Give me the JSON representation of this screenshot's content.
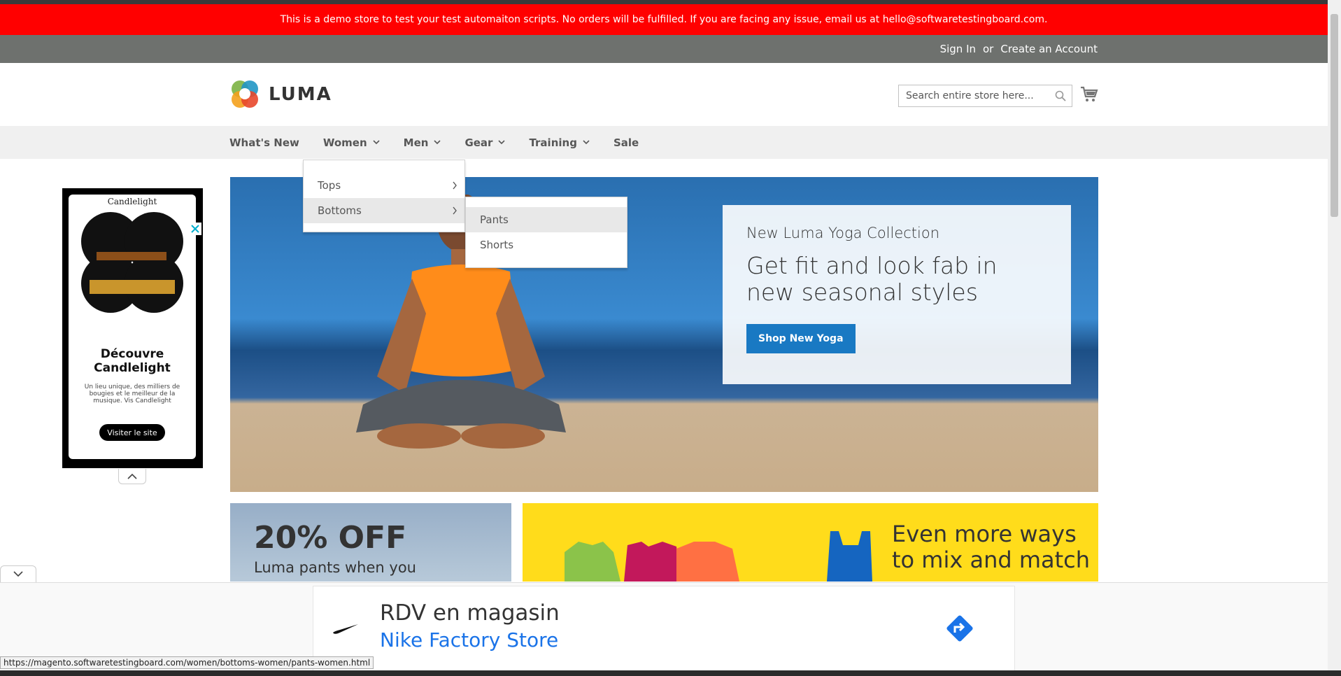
{
  "banner": {
    "text": "This is a demo store to test your test automaiton scripts. No orders will be fulfilled. If you are facing any issue, email us at hello@softwaretestingboard.com."
  },
  "panel": {
    "sign_in": "Sign In",
    "or": "or",
    "create_account": "Create an Account"
  },
  "logo": {
    "text": "LUMA"
  },
  "search": {
    "placeholder": "Search entire store here..."
  },
  "nav": {
    "items": [
      {
        "label": "What's New",
        "has_children": false
      },
      {
        "label": "Women",
        "has_children": true
      },
      {
        "label": "Men",
        "has_children": true
      },
      {
        "label": "Gear",
        "has_children": true
      },
      {
        "label": "Training",
        "has_children": true
      },
      {
        "label": "Sale",
        "has_children": false
      }
    ]
  },
  "dropdown": {
    "items": [
      "Tops",
      "Bottoms"
    ],
    "active": "Bottoms",
    "submenu": [
      "Pants",
      "Shorts"
    ],
    "submenu_active": "Pants"
  },
  "hero": {
    "kicker": "New Luma Yoga Collection",
    "title": "Get fit and look fab in new seasonal styles",
    "button": "Shop New Yoga"
  },
  "tiles": {
    "sale_big": "20% OFF",
    "sale_small": "Luma pants when you",
    "mix_text": "Even more ways to mix and match"
  },
  "side_ad": {
    "brand": "Candlelight",
    "title": "Découvre Candlelight",
    "body": "Un lieu unique, des milliers de bougies et le meilleur de la musique. Vis Candlelight",
    "button": "Visiter le site"
  },
  "bottom_ad": {
    "headline": "RDV en magasin",
    "sub": "Nike Factory Store"
  },
  "status_url": "https://magento.softwaretestingboard.com/women/bottoms-women/pants-women.html",
  "colors": {
    "banner": "#ff0000",
    "panel": "#6e716e",
    "nav_bg": "#f0f0f0",
    "primary_button": "#1979c3",
    "tile_yellow": "#ffdc1b",
    "ad_blue": "#1a73e8"
  },
  "icons": [
    "luma-logo-icon",
    "search-icon",
    "cart-icon",
    "chevron-down-icon",
    "chevron-right-icon",
    "ad-close-icon",
    "chevron-up-icon",
    "nike-swoosh-icon",
    "directions-icon"
  ]
}
